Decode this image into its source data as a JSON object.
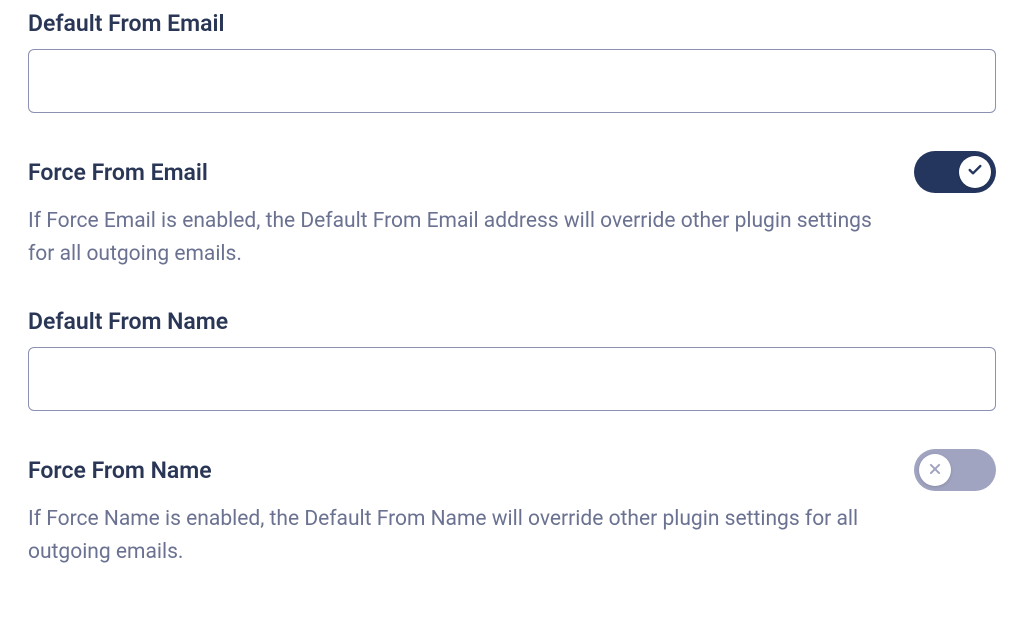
{
  "fields": {
    "default_from_email": {
      "label": "Default From Email",
      "value": ""
    },
    "force_from_email": {
      "label": "Force From Email",
      "enabled": true,
      "description": "If Force Email is enabled, the Default From Email address will override other plugin settings for all outgoing emails."
    },
    "default_from_name": {
      "label": "Default From Name",
      "value": ""
    },
    "force_from_name": {
      "label": "Force From Name",
      "enabled": false,
      "description": "If Force Name is enabled, the Default From Name will override other plugin settings for all outgoing emails."
    }
  }
}
